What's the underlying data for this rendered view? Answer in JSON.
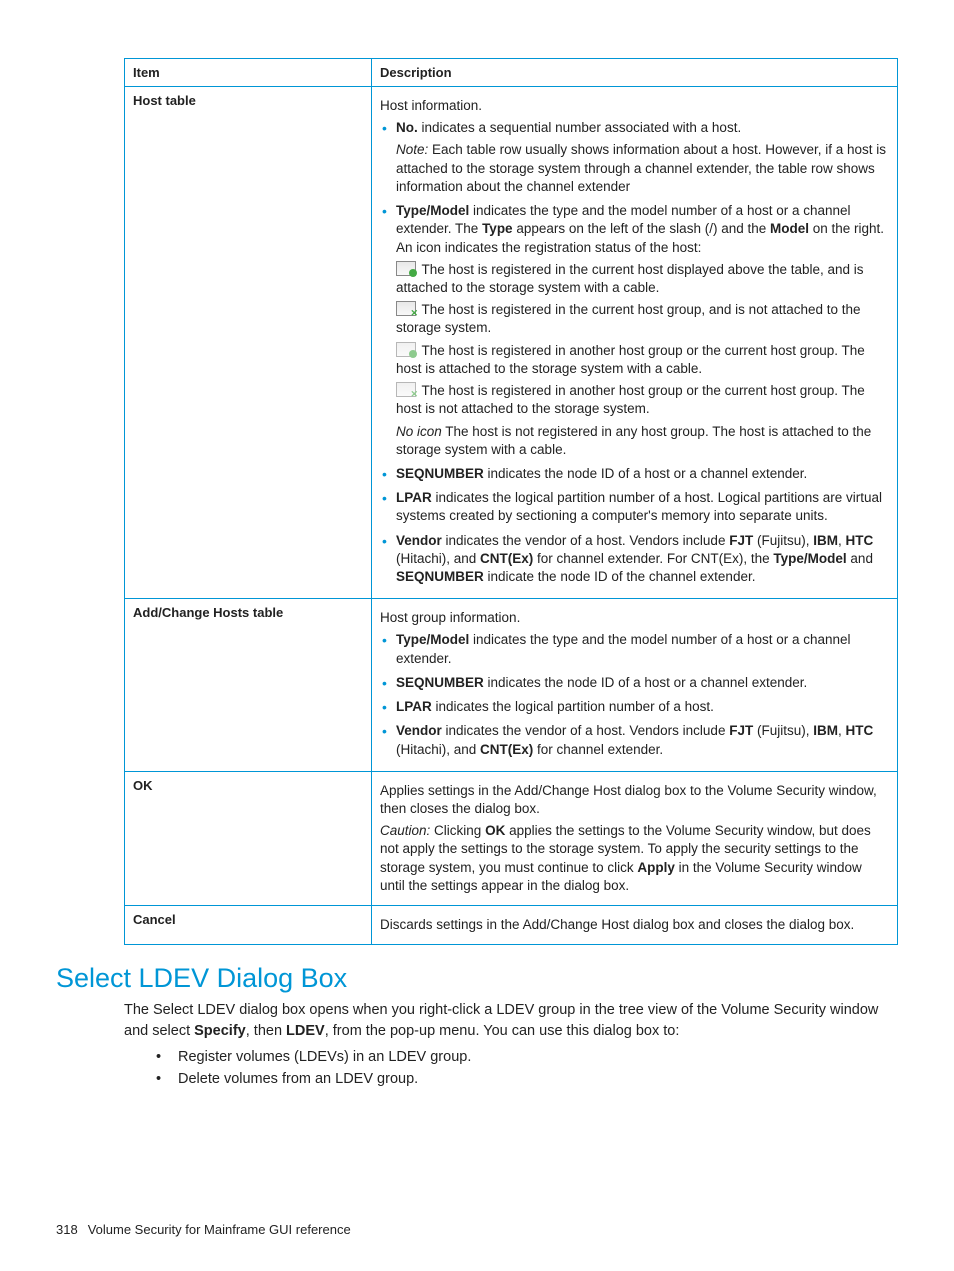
{
  "table": {
    "head_item": "Item",
    "head_desc": "Description",
    "rows": [
      {
        "item": "Host table",
        "intro": "Host information.",
        "bullets": [
          {
            "lead_bold": "No.",
            "text_after_lead": " indicates a sequential number associated with a host.",
            "note_italic": "Note:",
            "note_rest": " Each table row usually shows information about a host. However, if a host is attached to the storage system through a channel extender, the table row shows information about the channel extender"
          },
          {
            "lead_bold": "Type/Model",
            "text_after_lead": " indicates the type and the model number of a host or a channel extender. The ",
            "mid_bold": "Type",
            "text_mid2": " appears on the left of the slash (/) and the ",
            "mid_bold2": "Model",
            "text_tail": " on the right. An icon indicates the registration status of the host:",
            "icons": [
              {
                "cls": "green",
                "text": " The host is registered in the current host displayed above the table, and is attached to the storage system with a cable."
              },
              {
                "cls": "greenx",
                "text": " The host is registered in the current host group, and is not attached to the storage system."
              },
              {
                "cls": "dim green",
                "text": " The host is registered in another host group or the current host group. The host is attached to the storage system with a cable."
              },
              {
                "cls": "dim greenx",
                "text": " The host is registered in another host group or the current host group. The host is not attached to the storage system."
              }
            ],
            "noicon_italic": "No icon",
            "noicon_rest": " The host is not registered in any host group. The host is attached to the storage system with a cable."
          },
          {
            "lead_bold": "SEQNUMBER",
            "text_after_lead": " indicates the node ID of a host or a channel extender."
          },
          {
            "lead_bold": "LPAR",
            "text_after_lead": " indicates the logical partition number of a host. Logical partitions are virtual systems created by sectioning a computer's memory into separate units."
          },
          {
            "lead_bold": "Vendor",
            "text_after_lead": " indicates the vendor of a host. Vendors include ",
            "b1": "FJT",
            "t1": " (Fujitsu), ",
            "b2": "IBM",
            "t2": ", ",
            "b3": "HTC",
            "t3": " (Hitachi), and ",
            "b4": "CNT(Ex)",
            "t4": " for channel extender. For CNT(Ex), the ",
            "b5": "Type/Model",
            "t5": " and ",
            "b6": "SEQNUMBER",
            "t6": " indicate the node ID of the channel extender."
          }
        ]
      },
      {
        "item": "Add/Change Hosts table",
        "intro": "Host group information.",
        "bullets2": [
          {
            "lead_bold": "Type/Model",
            "text": " indicates the type and the model number of a host or a channel extender."
          },
          {
            "lead_bold": "SEQNUMBER",
            "text": " indicates the node ID of a host or a channel extender."
          },
          {
            "lead_bold": "LPAR",
            "text": " indicates the logical partition number of a host."
          },
          {
            "lead_bold": "Vendor",
            "pre": " indicates the vendor of a host. Vendors include ",
            "b1": "FJT",
            "t1": " (Fujitsu), ",
            "b2": "IBM",
            "t2": ", ",
            "b3": "HTC",
            "t3": " (Hitachi), and ",
            "b4": "CNT(Ex)",
            "t4": " for channel extender."
          }
        ]
      },
      {
        "item": "OK",
        "para1": "Applies settings in the Add/Change Host dialog box to the Volume Security window, then closes the dialog box.",
        "caution_italic": "Caution:",
        "caution_pre": " Clicking ",
        "caution_b1": "OK",
        "caution_mid": " applies the settings to the Volume Security window, but does not apply the settings to the storage system. To apply the security settings to the storage system, you must continue to click ",
        "caution_b2": "Apply",
        "caution_tail": " in the Volume Security window until the settings appear in the dialog box."
      },
      {
        "item": "Cancel",
        "para1": "Discards settings in the Add/Change Host dialog box and closes the dialog box."
      }
    ]
  },
  "section": {
    "title": "Select LDEV Dialog Box",
    "body_pre": "The Select LDEV dialog box opens when you right-click a LDEV group in the tree view of the Volume Security window and select ",
    "b1": "Specify",
    "mid1": ", then ",
    "b2": "LDEV",
    "tail": ", from the pop-up menu. You can use this dialog box to:",
    "bullets": [
      "Register volumes (LDEVs) in an LDEV group.",
      "Delete volumes from an LDEV group."
    ]
  },
  "footer": {
    "page": "318",
    "text": "Volume Security for Mainframe GUI reference"
  }
}
